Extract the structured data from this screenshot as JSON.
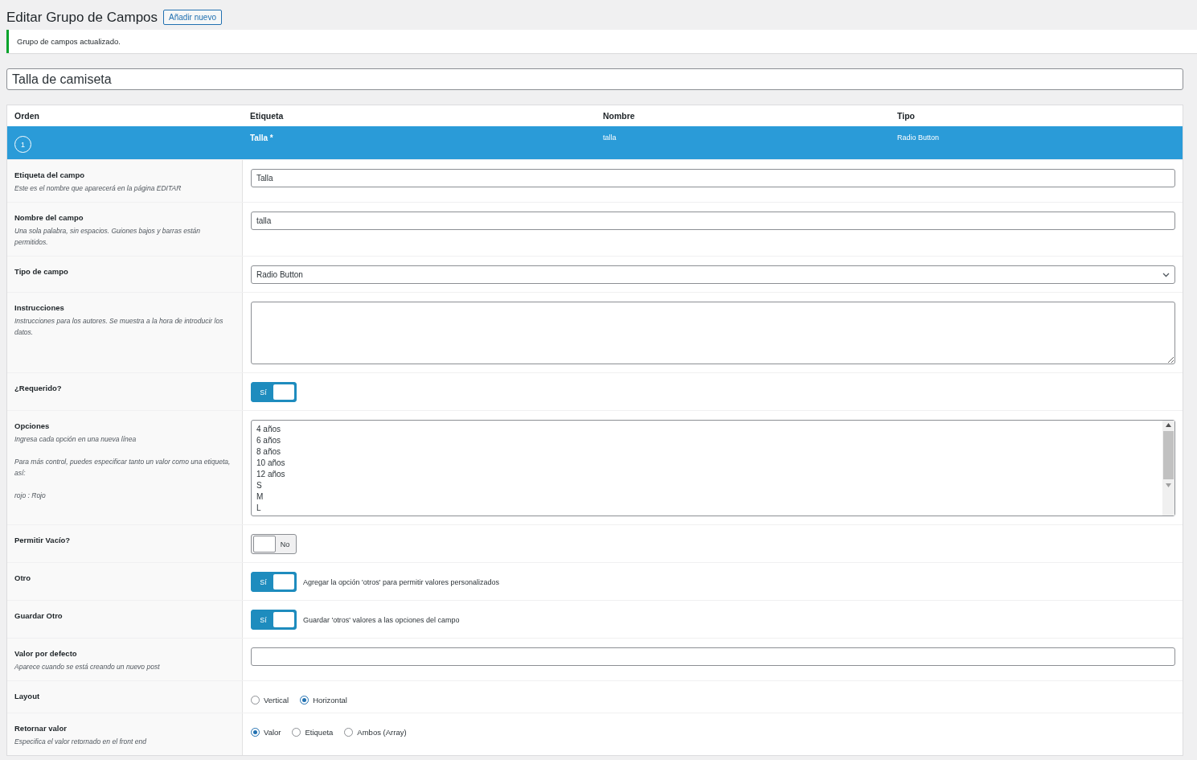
{
  "header": {
    "title": "Editar Grupo de Campos",
    "add_button": "Añadir nuevo"
  },
  "notice": {
    "text": "Grupo de campos actualizado."
  },
  "group_title": {
    "value": "Talla de camiseta"
  },
  "table": {
    "columns": [
      "Orden",
      "Etiqueta",
      "Nombre",
      "Tipo"
    ],
    "field_row": {
      "order": "1",
      "label": "Talla *",
      "name": "talla",
      "type": "Radio Button",
      "selected": true
    }
  },
  "settings": [
    {
      "kind": "text",
      "label": "Etiqueta del campo",
      "descriptions": [
        "Este es el nombre que aparecerá en la página EDITAR"
      ],
      "value": "Talla"
    },
    {
      "kind": "text",
      "label": "Nombre del campo",
      "descriptions": [
        "Una sola palabra, sin espacios. Guiones bajos y barras están permitidos."
      ],
      "value": "talla"
    },
    {
      "kind": "select",
      "label": "Tipo de campo",
      "value": "Radio Button"
    },
    {
      "kind": "textarea",
      "label": "Instrucciones",
      "descriptions": [
        "Instrucciones para los autores. Se muestra a la hora de introducir los datos."
      ]
    },
    {
      "kind": "toggle",
      "label": "¿Requerido?",
      "on": true,
      "switch_label": "Sí"
    },
    {
      "kind": "lines",
      "label": "Opciones",
      "descriptions": [
        "Ingresa cada opción en una nueva línea",
        "Para más control, puedes especificar tanto un valor como una etiqueta, así:",
        "rojo : Rojo"
      ],
      "lines": [
        "4 años",
        "6 años",
        "8 años",
        "10 años",
        "12 años",
        "S",
        "M",
        "L"
      ]
    },
    {
      "kind": "toggle",
      "label": "Permitir Vacío?",
      "on": false,
      "switch_label": "No"
    },
    {
      "kind": "toggle",
      "label": "Otro",
      "on": true,
      "switch_label": "Sí",
      "note": "Agregar la opción 'otros' para permitir valores personalizados"
    },
    {
      "kind": "toggle",
      "label": "Guardar Otro",
      "on": true,
      "switch_label": "Sí",
      "note": "Guardar 'otros' valores a las opciones del campo"
    },
    {
      "kind": "text",
      "label": "Valor por defecto",
      "descriptions": [
        "Aparece cuando se está creando un nuevo post"
      ]
    },
    {
      "kind": "radios",
      "label": "Layout",
      "options": [
        {
          "label": "Vertical",
          "selected": false
        },
        {
          "label": "Horizontal",
          "selected": true
        }
      ]
    },
    {
      "kind": "radios",
      "label": "Retornar valor",
      "descriptions": [
        "Especifica el valor retornado en el front end"
      ],
      "options": [
        {
          "label": "Valor",
          "selected": true
        },
        {
          "label": "Etiqueta",
          "selected": false
        },
        {
          "label": "Ambos (Array)",
          "selected": false
        }
      ]
    }
  ]
}
